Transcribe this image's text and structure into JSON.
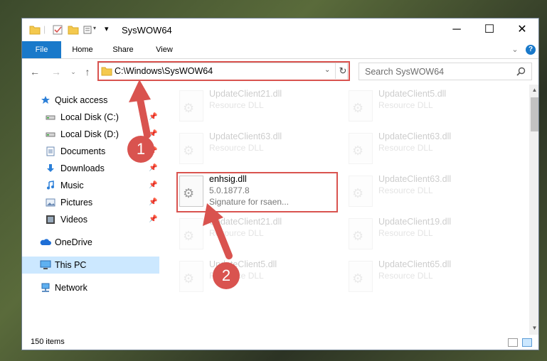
{
  "window": {
    "title": "SysWOW64",
    "controls": {
      "minimize": "─",
      "maximize": "☐",
      "close": "✕"
    }
  },
  "ribbon": {
    "tabs": [
      "File",
      "Home",
      "Share",
      "View"
    ],
    "expand_icon": "⌄",
    "help_icon": "?"
  },
  "address": {
    "path": "C:\\Windows\\SysWOW64",
    "dropdown": "⌄",
    "refresh": "↻",
    "search_placeholder": "Search SysWOW64"
  },
  "nav": {
    "back": "←",
    "forward": "→",
    "recent": "⌄",
    "up": "↑",
    "items": [
      {
        "label": "Quick access",
        "icon": "star-icon"
      },
      {
        "label": "Local Disk (C:)",
        "icon": "drive-icon",
        "pinned": true
      },
      {
        "label": "Local Disk (D:)",
        "icon": "drive-icon",
        "pinned": true
      },
      {
        "label": "Documents",
        "icon": "documents-icon",
        "pinned": true
      },
      {
        "label": "Downloads",
        "icon": "downloads-icon",
        "pinned": true
      },
      {
        "label": "Music",
        "icon": "music-icon",
        "pinned": true
      },
      {
        "label": "Pictures",
        "icon": "pictures-icon",
        "pinned": true
      },
      {
        "label": "Videos",
        "icon": "videos-icon",
        "pinned": true
      },
      {
        "label": "OneDrive",
        "icon": "onedrive-icon"
      },
      {
        "label": "This PC",
        "icon": "this-pc-icon",
        "selected": true
      },
      {
        "label": "Network",
        "icon": "network-icon"
      }
    ]
  },
  "files": {
    "left": [
      {
        "name": "UpdateClient21.dll",
        "type": "Resource DLL"
      },
      {
        "name": "UpdateClient63.dll",
        "type": "Resource DLL"
      },
      {
        "name": "enhsig.dll",
        "version": "5.0.1877.8",
        "description": "Signature for rsaen..."
      },
      {
        "name": "UpdateClient21.dll",
        "type": "Resource DLL"
      },
      {
        "name": "UpdateClient5.dll",
        "type": "Resource DLL"
      }
    ],
    "right": [
      {
        "name": "UpdateClient5.dll",
        "type": "Resource DLL"
      },
      {
        "name": "UpdateClient63.dll",
        "type": "Resource DLL"
      },
      {
        "name": "UpdateClient63.dll",
        "type": "Resource DLL"
      },
      {
        "name": "UpdateClient19.dll",
        "type": "Resource DLL"
      },
      {
        "name": "UpdateClient65.dll",
        "type": "Resource DLL"
      }
    ]
  },
  "status": {
    "items": "150 items"
  },
  "callouts": {
    "one": "1",
    "two": "2",
    "color": "#d9534f"
  }
}
